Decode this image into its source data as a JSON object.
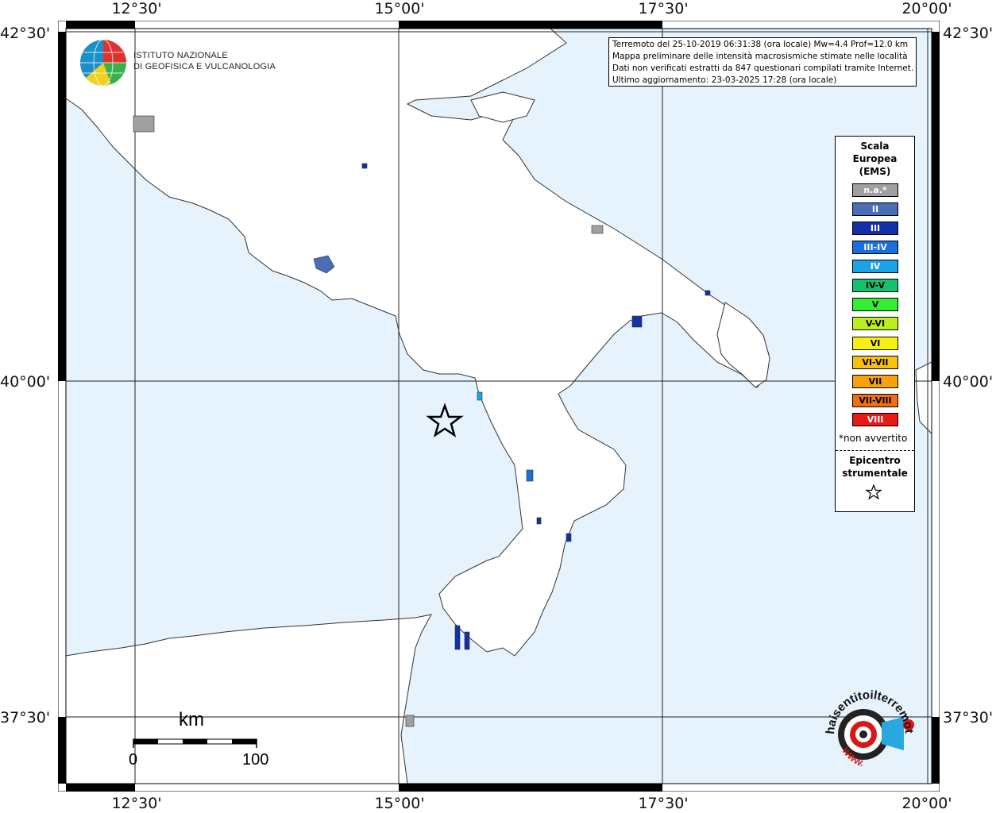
{
  "map": {
    "top_labels": [
      "12°30'",
      "15°00'",
      "17°30'",
      "20°00'"
    ],
    "bottom_labels": [
      "12°30'",
      "15°00'",
      "17°30'",
      "20°00'"
    ],
    "left_labels": [
      "42°30'",
      "40°00'",
      "37°30'"
    ],
    "right_labels": [
      "42°30'",
      "40°00'",
      "37°30'"
    ],
    "colors": {
      "sea": "#e6f2fc",
      "land": "#ffffff",
      "coast": "#333333",
      "grid": "#222222"
    }
  },
  "info": {
    "line1": "Terremoto del 25-10-2019 06:31:38 (ora locale) Mw=4.4 Prof=12.0 km",
    "line2": "Mappa preliminare delle intensità macrosismiche stimate nelle località",
    "line3": "Dati non verificati estratti da 847 questionari compilati tramite Internet.",
    "line4": "Ultimo aggiornamento: 23-03-2025 17:28 (ora locale)"
  },
  "legend": {
    "title1": "Scala",
    "title2": "Europea",
    "title3": "(EMS)",
    "items": [
      {
        "label": "n.a.*",
        "color": "#a0a0a0"
      },
      {
        "label": "II",
        "color": "#4a6db8"
      },
      {
        "label": "III",
        "color": "#1230a8"
      },
      {
        "label": "III-IV",
        "color": "#1a6fe0"
      },
      {
        "label": "IV",
        "color": "#1aa3e6"
      },
      {
        "label": "IV-V",
        "color": "#17c06a"
      },
      {
        "label": "V",
        "color": "#33ee33"
      },
      {
        "label": "V-VI",
        "color": "#b8f020"
      },
      {
        "label": "VI",
        "color": "#f8f012"
      },
      {
        "label": "VI-VII",
        "color": "#f8c010"
      },
      {
        "label": "VII",
        "color": "#f8a010"
      },
      {
        "label": "VII-VIII",
        "color": "#f07010"
      },
      {
        "label": "VIII",
        "color": "#e81818"
      }
    ],
    "note": "*non avvertito",
    "epicenter1": "Epicentro",
    "epicenter2": "strumentale"
  },
  "scale": {
    "title": "km",
    "min": "0",
    "max": "100"
  },
  "ingv": {
    "line1": "ISTITUTO NAZIONALE",
    "line2": "DI GEOFISICA E VULCANOLOGIA"
  },
  "logo": {
    "text": "haisentitoilterremoto.it",
    "www": "WWW."
  }
}
